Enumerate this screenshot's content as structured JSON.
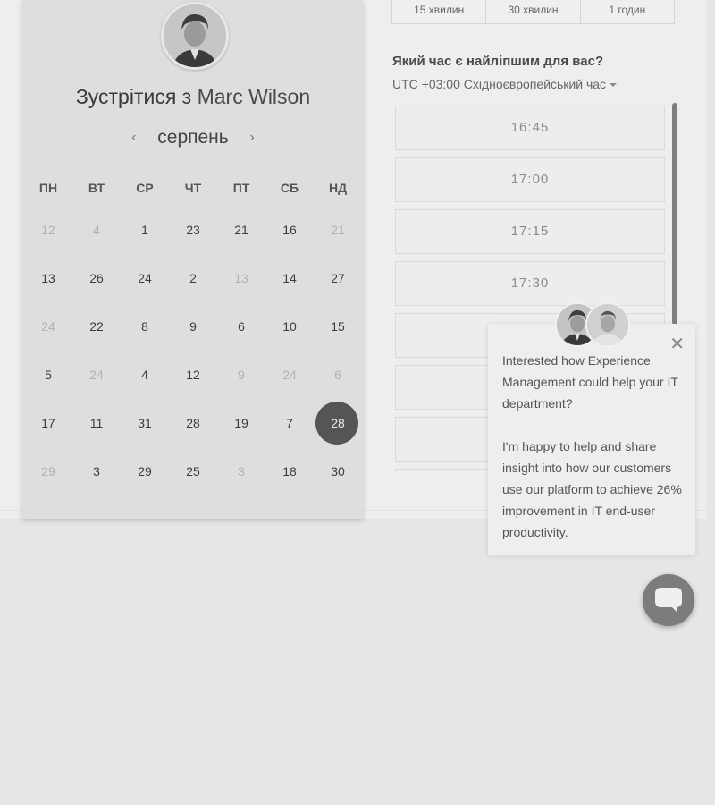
{
  "durations": [
    "15 хвилин",
    "30 хвилин",
    "1 годин"
  ],
  "meeting": {
    "title_prefix": "Зустрітися з",
    "host_name": "Marc Wilson"
  },
  "calendar": {
    "month": "серпень",
    "prev_icon": "chevron-left-icon",
    "next_icon": "chevron-right-icon",
    "weekdays": [
      "ПН",
      "ВТ",
      "СР",
      "ЧТ",
      "ПТ",
      "СБ",
      "НД"
    ],
    "weeks": [
      [
        {
          "d": "12",
          "dim": true
        },
        {
          "d": "4",
          "dim": true
        },
        {
          "d": "1"
        },
        {
          "d": "23"
        },
        {
          "d": "21"
        },
        {
          "d": "16"
        },
        {
          "d": "21",
          "dim": true
        }
      ],
      [
        {
          "d": "13"
        },
        {
          "d": "26"
        },
        {
          "d": "24"
        },
        {
          "d": "2"
        },
        {
          "d": "13",
          "dim": true
        },
        {
          "d": "14"
        },
        {
          "d": "27"
        }
      ],
      [
        {
          "d": "24",
          "dim": true
        },
        {
          "d": "22"
        },
        {
          "d": "8"
        },
        {
          "d": "9"
        },
        {
          "d": "6"
        },
        {
          "d": "10"
        },
        {
          "d": "15"
        }
      ],
      [
        {
          "d": "5"
        },
        {
          "d": "24",
          "dim": true
        },
        {
          "d": "4"
        },
        {
          "d": "12"
        },
        {
          "d": "9",
          "dim": true
        },
        {
          "d": "24",
          "dim": true
        },
        {
          "d": "6",
          "dim": true
        }
      ],
      [
        {
          "d": "17"
        },
        {
          "d": "11"
        },
        {
          "d": "31"
        },
        {
          "d": "28"
        },
        {
          "d": "19"
        },
        {
          "d": "7"
        },
        {
          "d": "28",
          "selected": true
        }
      ],
      [
        {
          "d": "29",
          "dim": true
        },
        {
          "d": "3"
        },
        {
          "d": "29"
        },
        {
          "d": "25"
        },
        {
          "d": "3",
          "dim": true
        },
        {
          "d": "18"
        },
        {
          "d": "30"
        }
      ]
    ]
  },
  "time": {
    "question": "Який час є найліпшим для вас?",
    "timezone": "UTC +03:00 Східноєвропейський час",
    "slots": [
      "16:45",
      "17:00",
      "17:15",
      "17:30",
      "",
      "",
      "",
      ""
    ]
  },
  "chat_popup": {
    "close_icon": "close-icon",
    "message_1": "Interested how Experience Management could help your IT department?",
    "message_2": "I'm happy to help and share insight into how our customers use our platform to achieve 26% improvement in IT end-user productivity."
  },
  "chat_launcher": {
    "icon": "chat-bubble-icon"
  },
  "colors": {
    "selected_day": "#555555",
    "page_bg": "#e6e6e6"
  }
}
